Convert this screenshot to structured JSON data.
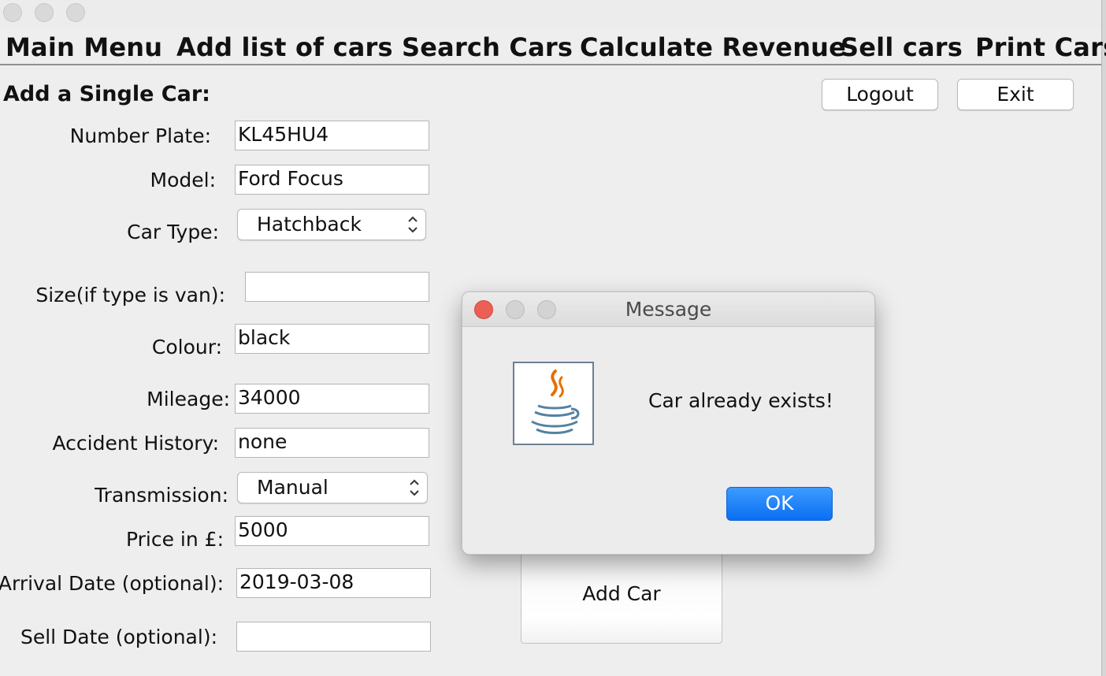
{
  "menu": {
    "items": [
      "Main Menu",
      "Add list of cars",
      "Search Cars",
      "Calculate Revenue",
      "Sell cars",
      "Print Cars"
    ]
  },
  "header": {
    "section_title": "Add a Single Car:",
    "logout_label": "Logout",
    "exit_label": "Exit"
  },
  "form": {
    "number_plate": {
      "label": "Number Plate:",
      "value": "KL45HU4"
    },
    "model": {
      "label": "Model:",
      "value": "Ford Focus"
    },
    "car_type": {
      "label": "Car Type:",
      "value": "Hatchback"
    },
    "size": {
      "label": "Size(if type is van):",
      "value": ""
    },
    "colour": {
      "label": "Colour:",
      "value": "black"
    },
    "mileage": {
      "label": "Mileage:",
      "value": "34000"
    },
    "accident_history": {
      "label": "Accident History:",
      "value": "none"
    },
    "transmission": {
      "label": "Transmission:",
      "value": "Manual"
    },
    "price": {
      "label": "Price in £:",
      "value": "5000"
    },
    "arrival_date": {
      "label": "Arrival Date (optional):",
      "value": "2019-03-08"
    },
    "sell_date": {
      "label": "Sell Date (optional):",
      "value": ""
    },
    "add_car_label": "Add Car"
  },
  "dialog": {
    "title": "Message",
    "message": "Car already exists!",
    "ok_label": "OK",
    "icon": "java-coffee-cup-icon"
  },
  "colors": {
    "window_bg": "#eeeeee",
    "ok_button": "#0a6ff2",
    "close_light": "#ec5f57"
  }
}
